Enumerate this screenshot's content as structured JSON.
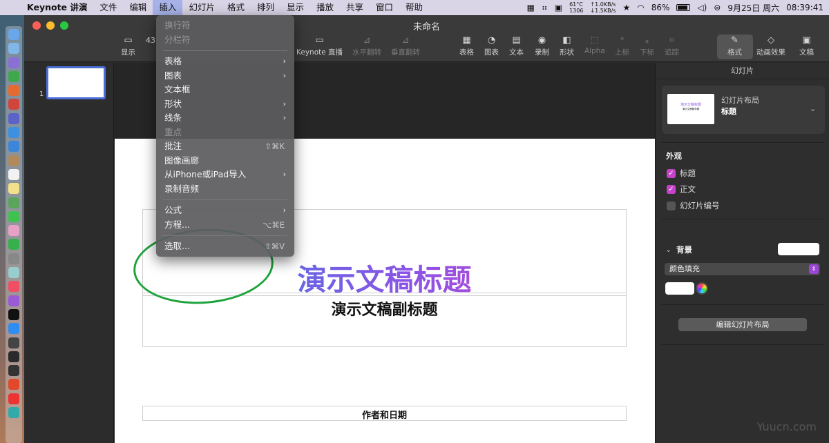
{
  "menubar": {
    "app": "Keynote 讲演",
    "items": [
      "文件",
      "编辑",
      "插入",
      "幻灯片",
      "格式",
      "排列",
      "显示",
      "播放",
      "共享",
      "窗口",
      "帮助"
    ],
    "active": "插入",
    "temp": "61°C",
    "rpm": "1306",
    "net_up": "↑1.0KB/s",
    "net_down": "↓1.5KB/s",
    "battery": "86%",
    "date": "9月25日 周六",
    "time": "08:39:41"
  },
  "window": {
    "title": "未命名",
    "toolbar": {
      "view": "显示",
      "zoom": "43",
      "keynote_live": "Keynote 直播",
      "flip_h": "水平翻转",
      "flip_v": "垂直翻转",
      "table": "表格",
      "chart": "图表",
      "text": "文本",
      "record": "录制",
      "shape": "形状",
      "alpha": "Alpha",
      "superscript": "上标",
      "subscript": "下标",
      "crop": "追踪",
      "format": "格式",
      "animate": "动画效果",
      "document": "文稿"
    }
  },
  "navigator": {
    "slide_number": "1"
  },
  "slide": {
    "title": "演示文稿标题",
    "subtitle": "演示文稿副标题",
    "author": "作者和日期"
  },
  "insert_menu": {
    "items": [
      {
        "label": "换行符",
        "disabled": true
      },
      {
        "label": "分栏符",
        "disabled": true
      },
      {
        "label": "表格",
        "submenu": true
      },
      {
        "label": "图表",
        "submenu": true
      },
      {
        "label": "文本框"
      },
      {
        "label": "形状",
        "submenu": true
      },
      {
        "label": "线条",
        "submenu": true
      },
      {
        "label": "重点",
        "disabled": true
      },
      {
        "label": "批注",
        "shortcut": "⇧⌘K"
      },
      {
        "label": "图像画廊"
      },
      {
        "label": "从iPhone或iPad导入",
        "submenu": true
      },
      {
        "label": "录制音频"
      },
      {
        "label": "公式",
        "submenu": true
      },
      {
        "label": "方程...",
        "shortcut": "⌥⌘E"
      },
      {
        "label": "选取...",
        "shortcut": "⇧⌘V"
      }
    ]
  },
  "inspector": {
    "header": "幻灯片",
    "layout_label": "幻灯片布局",
    "layout_name": "标题",
    "layout_thumb_title": "演示文稿标题",
    "layout_thumb_sub": "演示文稿副标题",
    "appearance": "外观",
    "opt_title": "标题",
    "opt_body": "正文",
    "opt_number": "幻灯片编号",
    "background": "背景",
    "fill_type": "颜色填充",
    "edit_layout": "编辑幻灯片布局"
  },
  "watermark": "Yuucn.com",
  "colors": {
    "accent": "#c443c8",
    "title_gradient_start": "#3d7de0",
    "title_gradient_end": "#d63cc4",
    "annotation": "#1fa33d"
  }
}
